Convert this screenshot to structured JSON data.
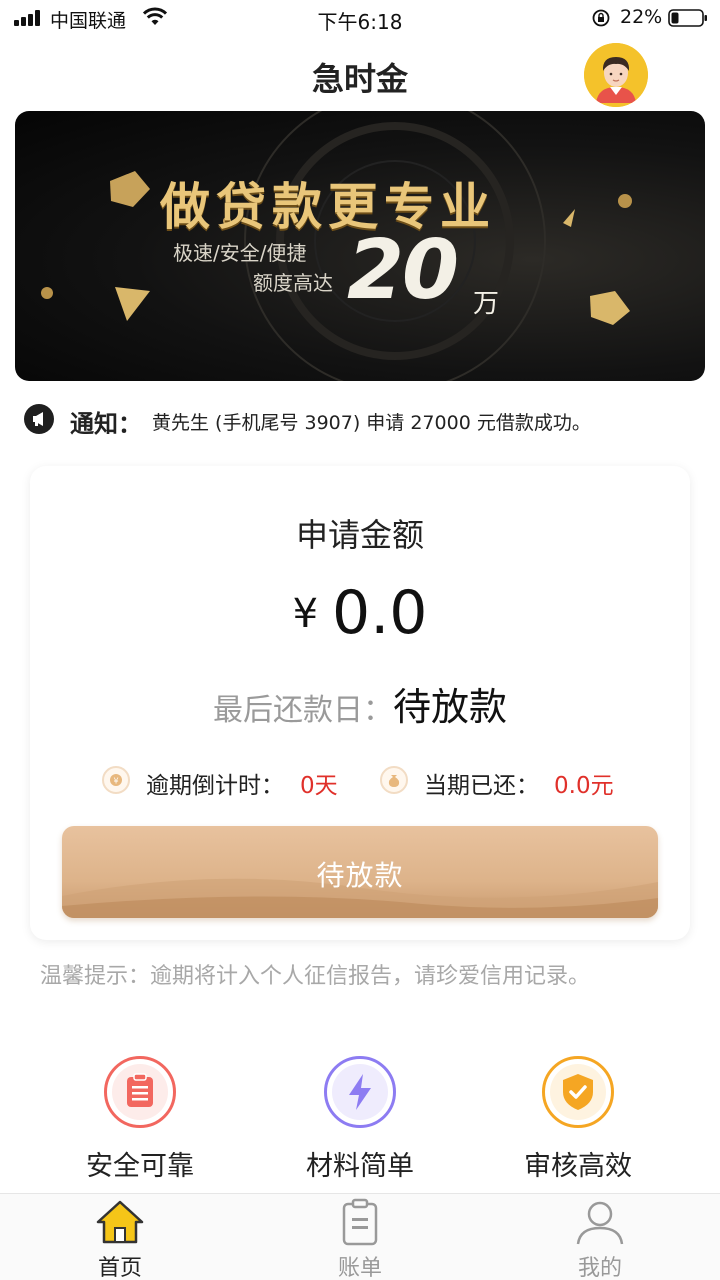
{
  "status_bar": {
    "carrier": "中国联通",
    "time": "下午6:18",
    "battery_percent": "22%",
    "battery_level": 0.22
  },
  "header": {
    "title": "急时金",
    "avatar_icon": "user-avatar-icon"
  },
  "banner": {
    "headline": "做贷款更专业",
    "tags": "极速/安全/便捷",
    "limit_text": "额度高达",
    "amount": "20",
    "unit": "万"
  },
  "notice": {
    "label": "通知：",
    "text": "黄先生 (手机尾号 3907) 申请 27000 元借款成功。"
  },
  "card": {
    "title": "申请金额",
    "currency": "¥",
    "amount": "0.0",
    "due_label": "最后还款日：",
    "due_value": "待放款",
    "countdown_label": "逾期倒计时：",
    "countdown_value": "0天",
    "repaid_label": "当期已还：",
    "repaid_value": "0.0元",
    "button_label": "待放款"
  },
  "tip": "温馨提示：逾期将计入个人征信报告，请珍爱信用记录。",
  "features": [
    {
      "label": "安全可靠",
      "icon": "clipboard-icon",
      "color": "#f2675f"
    },
    {
      "label": "材料简单",
      "icon": "lightning-icon",
      "color": "#8d7cf2"
    },
    {
      "label": "审核高效",
      "icon": "shield-check-icon",
      "color": "#f5a623"
    }
  ],
  "tabs": [
    {
      "label": "首页",
      "icon": "home-icon",
      "active": true
    },
    {
      "label": "账单",
      "icon": "bill-icon",
      "active": false
    },
    {
      "label": "我的",
      "icon": "profile-icon",
      "active": false
    }
  ],
  "colors": {
    "accent_red": "#e0302a",
    "button_gold": "#ddb38a",
    "banner_gold": "#e9c67a"
  }
}
